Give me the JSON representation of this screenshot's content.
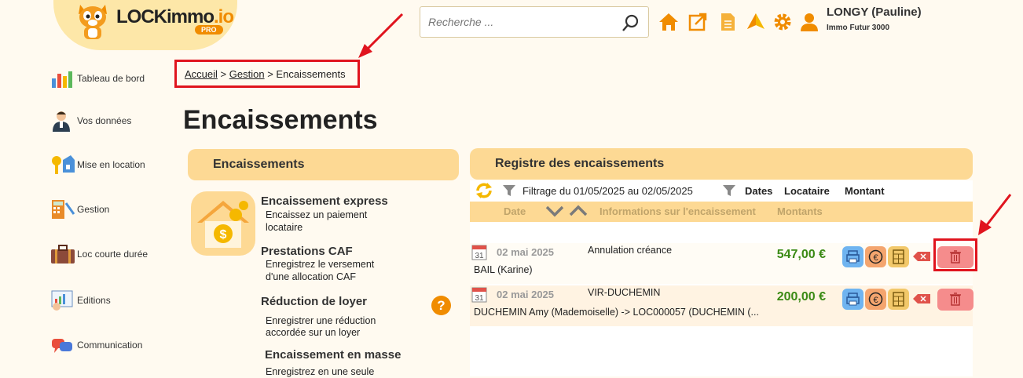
{
  "header": {
    "logo_text": "LOCKimmo",
    "logo_suffix": ".io",
    "logo_badge": "PRO",
    "search_placeholder": "Recherche ...",
    "user_name": "LONGY (Pauline)",
    "user_org": "Immo Futur 3000"
  },
  "sidebar": {
    "items": [
      {
        "label": "Tableau de bord",
        "icon": "dashboard-icon"
      },
      {
        "label": "Vos données",
        "icon": "user-data-icon"
      },
      {
        "label": "Mise en location",
        "icon": "keys-house-icon"
      },
      {
        "label": "Gestion",
        "icon": "calculator-icon"
      },
      {
        "label": "Loc courte durée",
        "icon": "suitcase-icon"
      },
      {
        "label": "Editions",
        "icon": "chart-report-icon"
      },
      {
        "label": "Communication",
        "icon": "chat-bubbles-icon"
      }
    ]
  },
  "breadcrumb": {
    "home": "Accueil",
    "sep1": ">",
    "section": "Gestion",
    "sep2": ">",
    "current": "Encaissements"
  },
  "page_title": "Encaissements",
  "left_panel": {
    "title": "Encaissements",
    "options": [
      {
        "title": "Encaissement express",
        "desc1": "Encaissez un paiement",
        "desc2": "locataire"
      },
      {
        "title": "Prestations CAF",
        "desc1": "Enregistrez le versement",
        "desc2": "d'une allocation CAF"
      },
      {
        "title": "Réduction de loyer",
        "desc1": "Enregistrer une réduction",
        "desc2": "accordée sur un loyer"
      },
      {
        "title": "Encaissement en masse",
        "desc1": "Enregistrez en une seule",
        "desc2": ""
      }
    ],
    "help": "?"
  },
  "right_panel": {
    "title": "Registre des encaissements",
    "filter_text": "Filtrage du 01/05/2025 au 02/05/2025",
    "sort_labels": {
      "dates": "Dates",
      "locataire": "Locataire",
      "montant": "Montant"
    },
    "columns": {
      "date": "Date",
      "info": "Informations sur l'encaissement",
      "amounts": "Montants"
    },
    "rows": [
      {
        "cal_day": "31",
        "date": "02 mai 2025",
        "info": "Annulation créance",
        "tenant": "BAIL (Karine)",
        "amount": "547,00 €"
      },
      {
        "cal_day": "31",
        "date": "02 mai 2025",
        "info": "VIR-DUCHEMIN",
        "tenant": "DUCHEMIN Amy (Mademoiselle) -> LOC000057 (DUCHEMIN (...",
        "amount": "200,00 €"
      }
    ]
  },
  "colors": {
    "accent": "#f08c00",
    "panel": "#fdd994",
    "highlight": "#e0141e",
    "amount": "#3a8a14"
  }
}
